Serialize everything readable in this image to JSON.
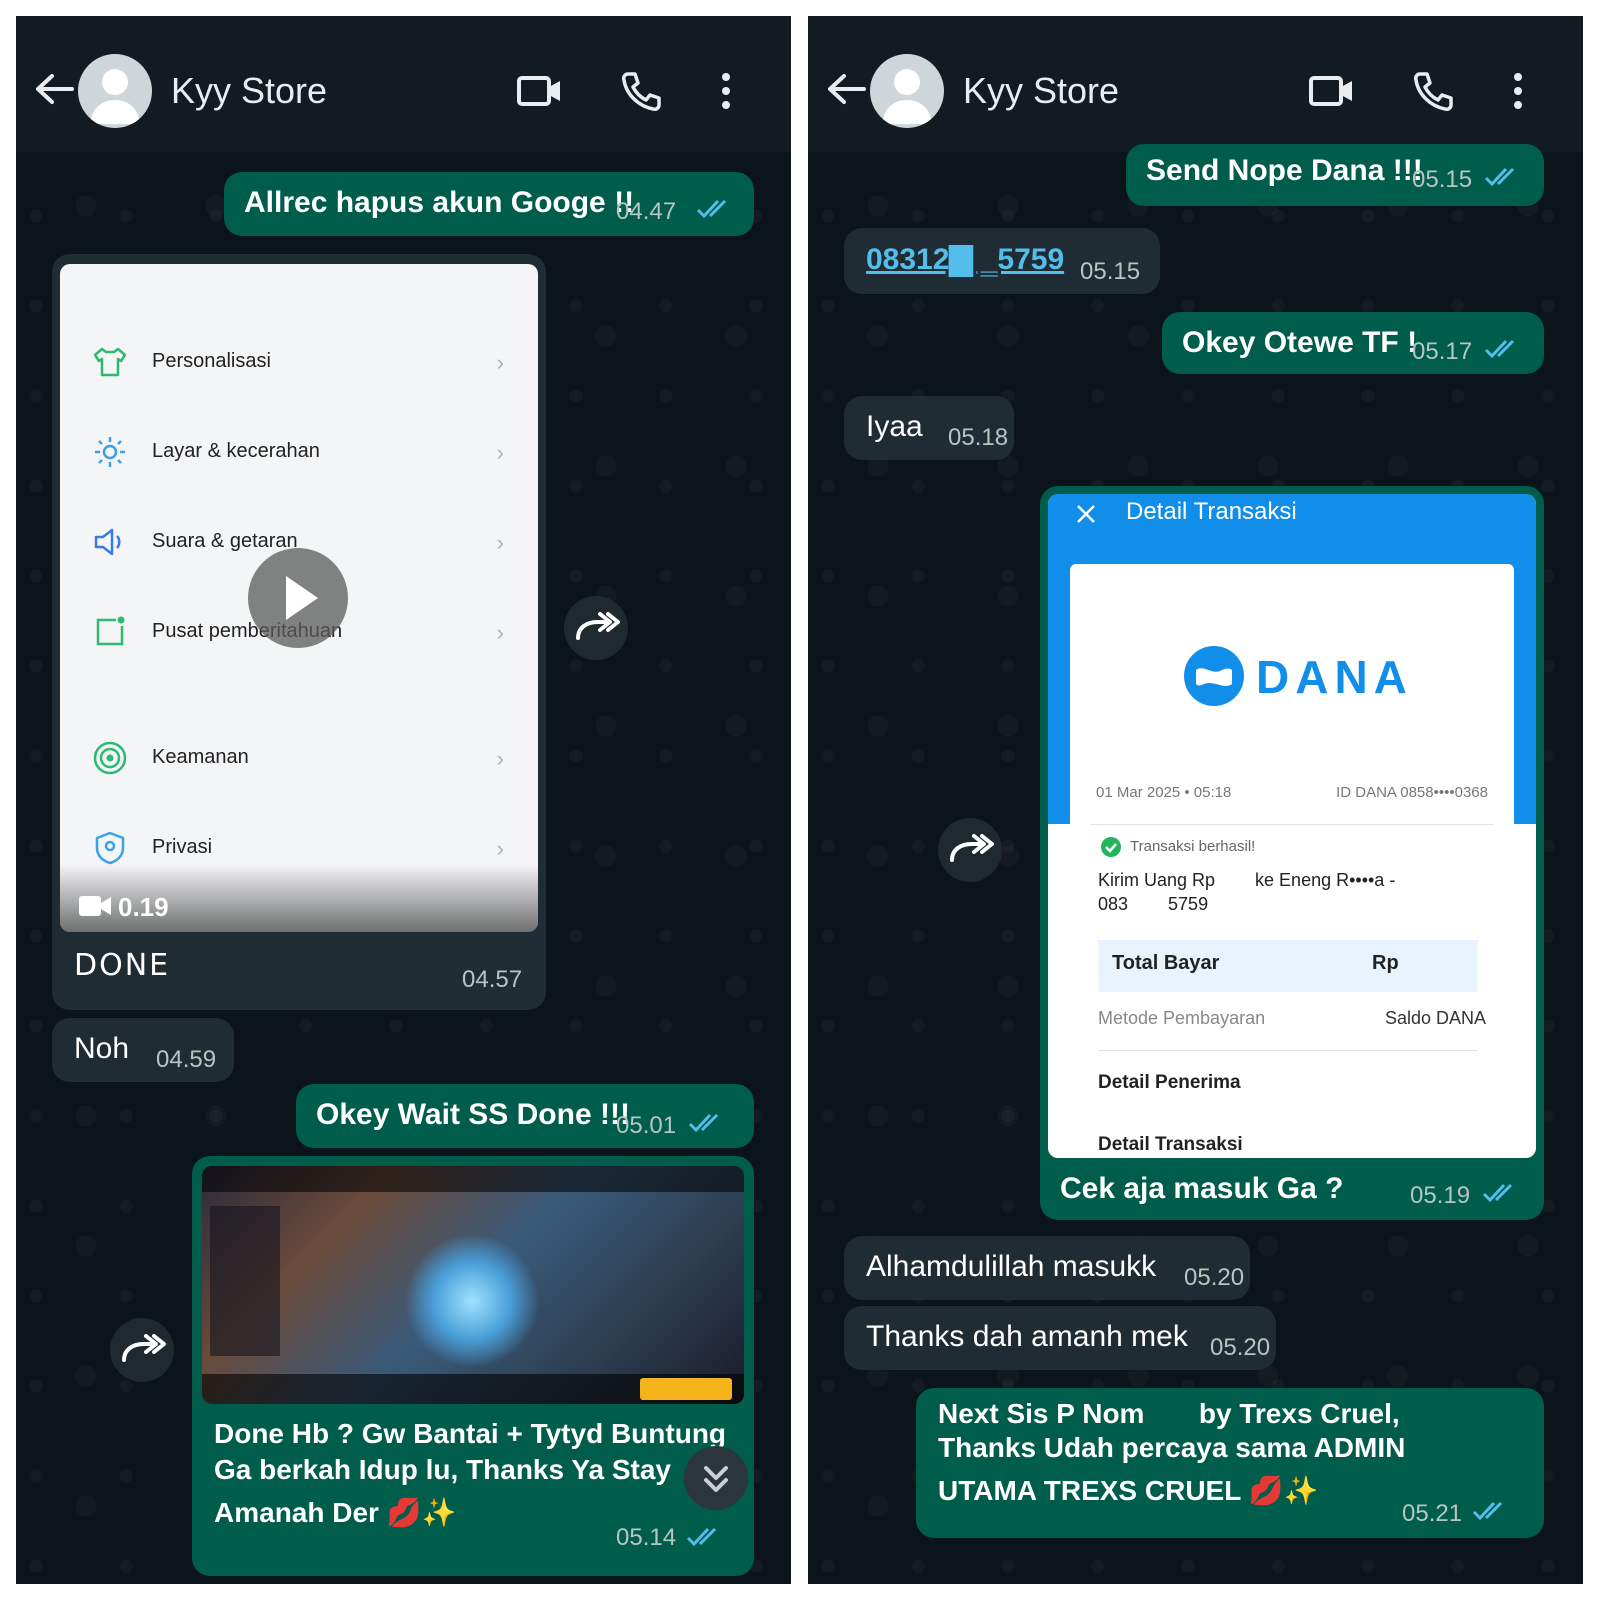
{
  "left": {
    "header": {
      "title": "Kyy Store"
    },
    "messages": [
      {
        "text": "Allrec hapus akun Googe !!",
        "time": "04.47"
      },
      {
        "caption": "DONE",
        "time": "04.57",
        "duration": "0.19"
      },
      {
        "text": "Noh",
        "time": "04.59"
      },
      {
        "text": "Okey Wait SS Done !!!",
        "time": "05.01"
      },
      {
        "line1": "Done Hb ? Gw Bantai + Tytyd Buntung",
        "line2": "Ga berkah Idup lu, Thanks Ya Stay",
        "line3": "Amanah Der 💋✨",
        "time": "05.14"
      }
    ],
    "video_menu": [
      {
        "label": "Personalisasi",
        "icon": "shirt-icon"
      },
      {
        "label": "Layar & kecerahan",
        "icon": "brightness-icon"
      },
      {
        "label": "Suara & getaran",
        "icon": "speaker-icon"
      },
      {
        "label": "Pusat pemberitahuan",
        "icon": "notification-icon"
      },
      {
        "label": "Keamanan",
        "icon": "security-icon"
      },
      {
        "label": "Privasi",
        "icon": "privacy-icon"
      }
    ]
  },
  "right": {
    "header": {
      "title": "Kyy Store"
    },
    "messages": [
      {
        "text": "Send Nope Dana !!!",
        "time": "05.15"
      },
      {
        "text": "08312▇ ‗5759",
        "time": "05.15"
      },
      {
        "text": "Okey Otewe TF !",
        "time": "05.17"
      },
      {
        "text": "Iyaa",
        "time": "05.18"
      },
      {
        "text": "Cek aja masuk Ga ?",
        "time": "05.19"
      },
      {
        "text": "Alhamdulillah masukk",
        "time": "05.20"
      },
      {
        "text": "Thanks dah amanh mek",
        "time": "05.20"
      },
      {
        "line1": "Next Sis P Nom       by Trexs Cruel,",
        "line2": "Thanks Udah percaya sama ADMIN",
        "line3": "UTAMA TREXS CRUEL 💋✨",
        "time": "05.21"
      }
    ],
    "dana": {
      "topbar": "Detail Transaksi",
      "logo": "DANA",
      "date": "01 Mar 2025 • 05:18",
      "id": "ID DANA 0858••••0368",
      "status": "Transaksi berhasil!",
      "desc1": "Kirim Uang Rp        ke Eneng R••••a -",
      "desc2": "083        5759",
      "total_label": "Total Bayar",
      "total_value": "Rp",
      "method_label": "Metode Pembayaran",
      "method_value": "Saldo DANA",
      "recipient": "Detail Penerima",
      "detail": "Detail Transaksi"
    }
  },
  "colors": {
    "outgoing": "#005c4b",
    "incoming": "#202c33",
    "header": "#121b22",
    "background": "#0b141a",
    "ticks": "#53bdeb",
    "dana_blue": "#118eea"
  }
}
